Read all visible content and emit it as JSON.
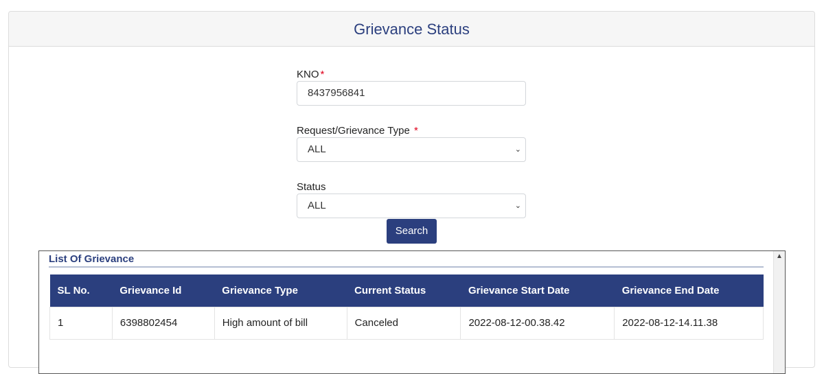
{
  "header": {
    "title": "Grievance Status"
  },
  "form": {
    "kno_label": "KNO",
    "required_mark": "*",
    "kno_value": "8437956841",
    "type_label": "Request/Grievance Type",
    "type_value": "ALL",
    "status_label": "Status",
    "status_value": "ALL",
    "search_label": "Search"
  },
  "list": {
    "title": "List Of Grievance",
    "columns": [
      "SL No.",
      "Grievance Id",
      "Grievance Type",
      "Current Status",
      "Grievance Start Date",
      "Grievance End Date"
    ],
    "rows": [
      [
        "1",
        "6398802454",
        "High amount of bill",
        "Canceled",
        "2022-08-12-00.38.42",
        "2022-08-12-14.11.38"
      ]
    ]
  }
}
